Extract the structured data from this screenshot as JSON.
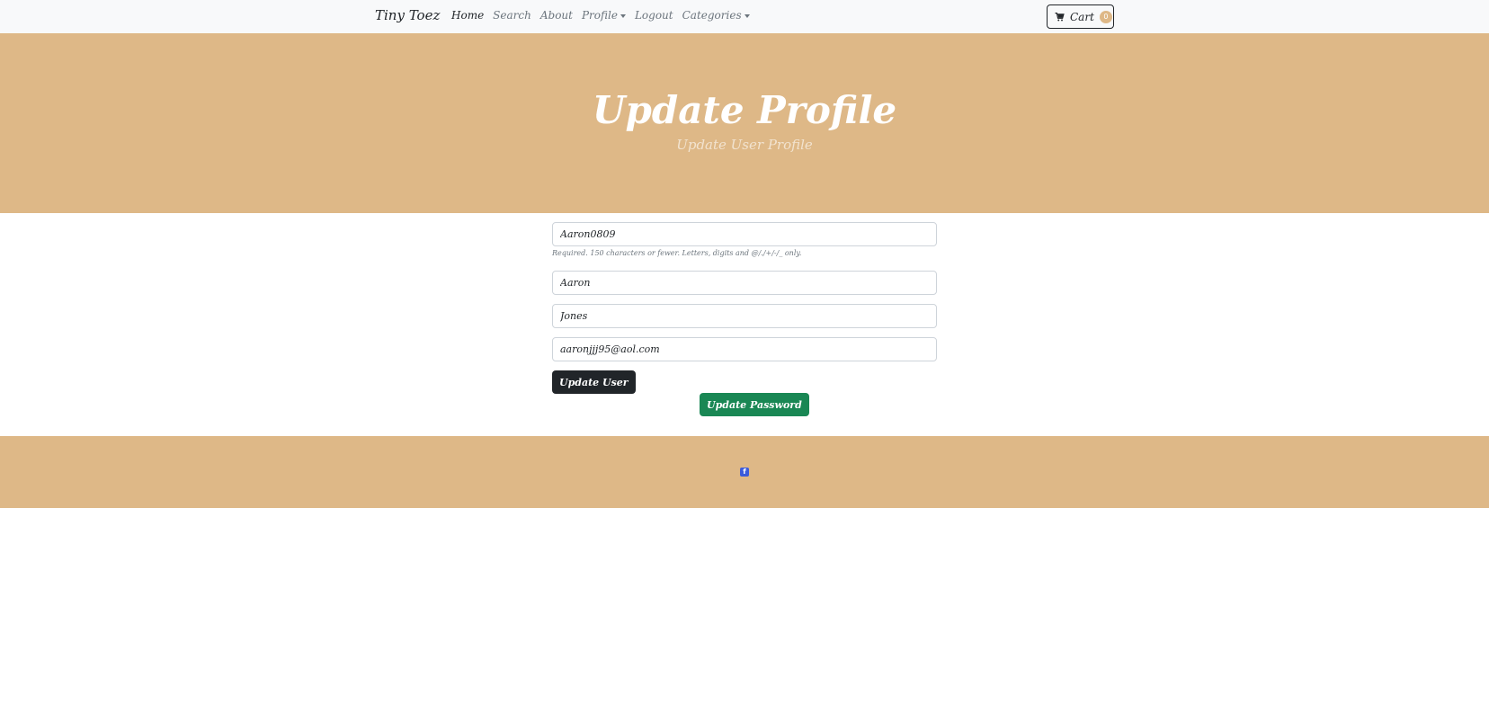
{
  "navbar": {
    "brand": "Tiny Toez",
    "links": [
      {
        "label": "Home"
      },
      {
        "label": "Search"
      },
      {
        "label": "About"
      },
      {
        "label": "Profile"
      },
      {
        "label": "Logout"
      },
      {
        "label": "Categories"
      }
    ],
    "cart": {
      "label": "Cart",
      "count": "0"
    }
  },
  "hero": {
    "title": "Update Profile",
    "subtitle": "Update User Profile"
  },
  "form": {
    "username": "Aaron0809",
    "username_help": "Required. 150 characters or fewer. Letters, digits and @/./+/-/_ only.",
    "first_name": "Aaron",
    "last_name": "Jones",
    "email": "aaronjjj95@aol.com",
    "update_user_label": "Update User",
    "update_password_label": "Update Password"
  },
  "colors": {
    "accent": "#deb887",
    "success": "#198754",
    "dark": "#212529",
    "facebook": "#3b5bdb"
  },
  "icons": {
    "cart": "cart-icon",
    "facebook": "facebook-icon"
  }
}
